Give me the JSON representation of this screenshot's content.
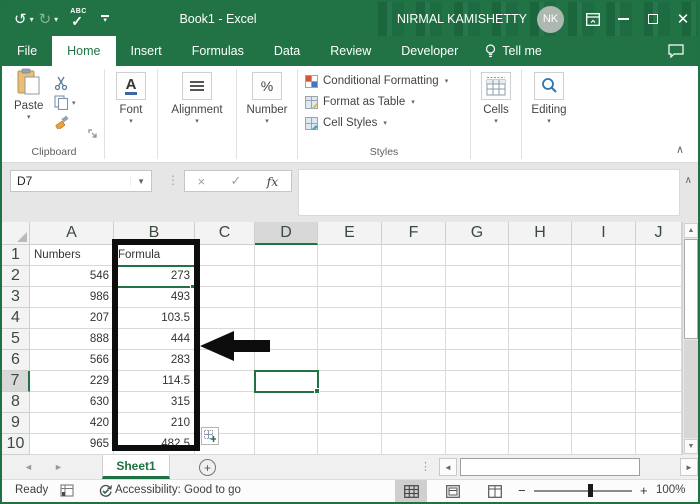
{
  "window": {
    "title": "Book1 - Excel",
    "user_name": "NIRMAL KAMISHETTY",
    "avatar_initials": "NK"
  },
  "qat": {
    "undo_glyph": "↺",
    "redo_glyph": "↻",
    "spell_abc": "ABC",
    "spell_check": "✓",
    "dropdown_glyph": "▾"
  },
  "menu": {
    "tabs": [
      {
        "label": "File",
        "active": false
      },
      {
        "label": "Home",
        "active": true
      },
      {
        "label": "Insert",
        "active": false
      },
      {
        "label": "Formulas",
        "active": false
      },
      {
        "label": "Data",
        "active": false
      },
      {
        "label": "Review",
        "active": false
      },
      {
        "label": "Developer",
        "active": false
      }
    ],
    "tell_me": "Tell me"
  },
  "ribbon": {
    "clipboard": {
      "paste_label": "Paste",
      "group_label": "Clipboard"
    },
    "font": {
      "label": "Font",
      "icon_letter": "A"
    },
    "alignment": {
      "label": "Alignment"
    },
    "number": {
      "label": "Number",
      "icon_symbol": "%"
    },
    "styles": {
      "items": [
        "Conditional Formatting",
        "Format as Table",
        "Cell Styles"
      ],
      "group_label": "Styles"
    },
    "cells": {
      "label": "Cells"
    },
    "editing": {
      "label": "Editing"
    }
  },
  "formula_bar": {
    "name_box_value": "D7",
    "cancel_glyph": "×",
    "enter_glyph": "✓",
    "fx_label": "fx",
    "formula_value": ""
  },
  "grid": {
    "columns": [
      "A",
      "B",
      "C",
      "D",
      "E",
      "F",
      "G",
      "H",
      "I",
      "J"
    ],
    "selected_cell": "D7",
    "selected_column": "D",
    "selected_row": "7",
    "rows": [
      {
        "n": "1",
        "a": "Numbers",
        "b": "Formula"
      },
      {
        "n": "2",
        "a": "546",
        "b": "273"
      },
      {
        "n": "3",
        "a": "986",
        "b": "493"
      },
      {
        "n": "4",
        "a": "207",
        "b": "103.5"
      },
      {
        "n": "5",
        "a": "888",
        "b": "444"
      },
      {
        "n": "6",
        "a": "566",
        "b": "283"
      },
      {
        "n": "7",
        "a": "229",
        "b": "114.5"
      },
      {
        "n": "8",
        "a": "630",
        "b": "315"
      },
      {
        "n": "9",
        "a": "420",
        "b": "210"
      },
      {
        "n": "10",
        "a": "965",
        "b": "482.5"
      }
    ]
  },
  "sheet_bar": {
    "tabs": [
      "Sheet1"
    ],
    "active_tab": "Sheet1",
    "add_sheet_glyph": "+"
  },
  "status_bar": {
    "ready_label": "Ready",
    "accessibility_label": "Accessibility: Good to go",
    "zoom_level": "100%"
  },
  "colors": {
    "excel_green": "#217346",
    "selection_green": "#217346",
    "annotation_black": "#0d0d0d"
  }
}
